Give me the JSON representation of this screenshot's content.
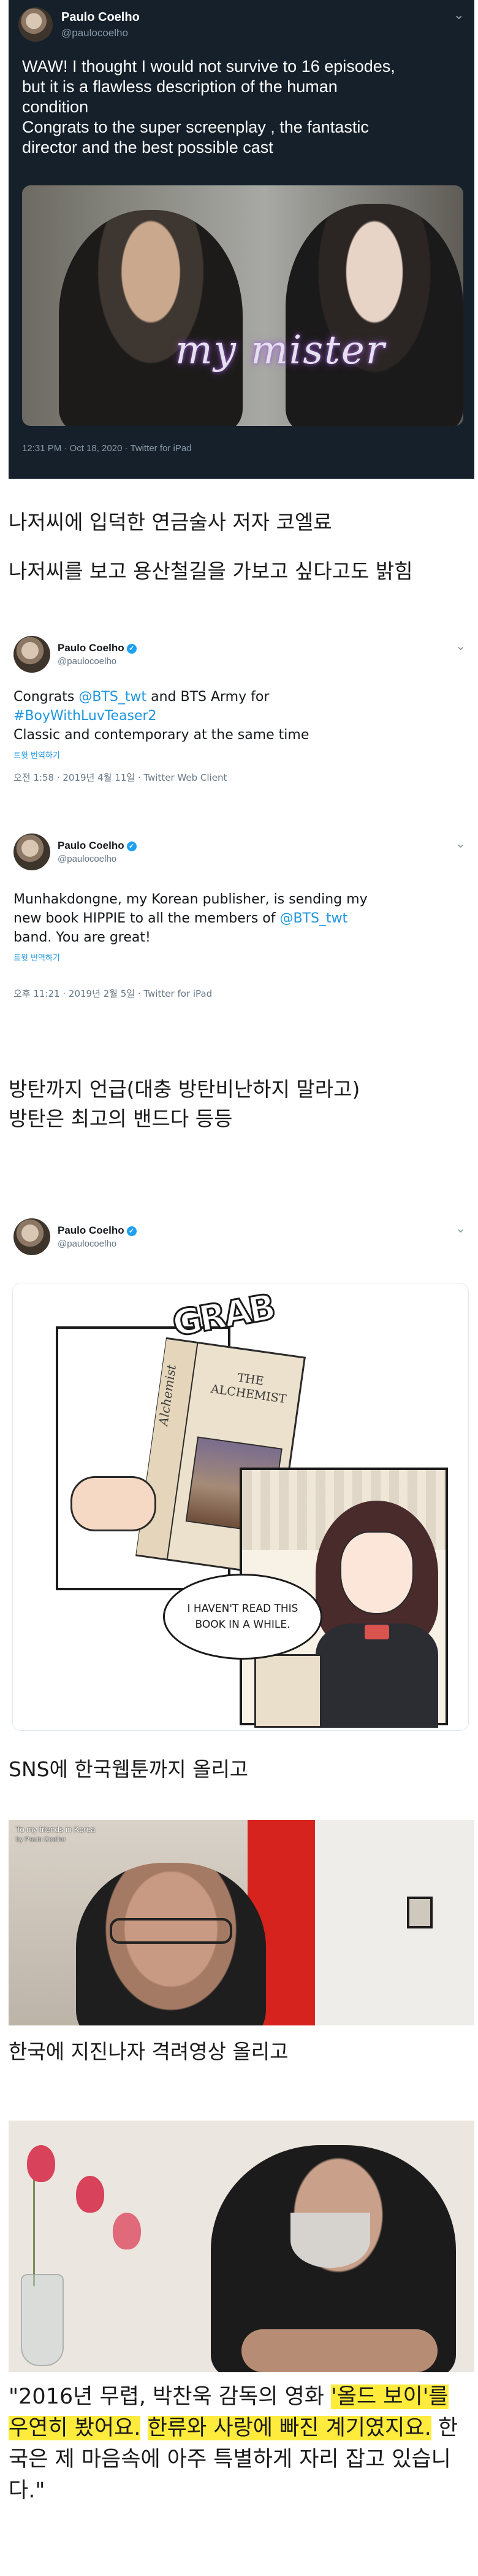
{
  "tweet1": {
    "name": "Paulo Coelho",
    "handle": "@paulocoelho",
    "text_lines": [
      "WAW! I thought I would not survive to 16 episodes,",
      "but it is a flawless description of the human",
      "condition",
      "Congrats to the super screenplay , the fantastic",
      "director and the best possible cast"
    ],
    "image_title": "my mister",
    "meta": "12:31 PM · Oct 18, 2020 · Twitter for iPad"
  },
  "caption1": "나저씨에 입덕한 연금술사 저자 코엘료",
  "caption2": "나저씨를 보고 용산철길을 가보고 싶다고도 밝힘",
  "tweet2": {
    "name": "Paulo Coelho",
    "handle": "@paulocoelho",
    "line1_pre": "Congrats ",
    "line1_mention": "@BTS_twt",
    "line1_post": " and BTS Army for",
    "line2_hashtag": "#BoyWithLuvTeaser2",
    "line3": "Classic and contemporary at the same time",
    "translate": "트윗 번역하기",
    "meta": "오전 1:58 · 2019년 4월 11일 · Twitter Web Client"
  },
  "tweet3": {
    "name": "Paulo Coelho",
    "handle": "@paulocoelho",
    "line1": "Munhakdongne, my Korean publisher, is sending my",
    "line2_pre": "new book HIPPIE to all the members of ",
    "line2_mention": "@BTS_twt",
    "line3": "band. You are great!",
    "translate": "트윗 번역하기",
    "meta": "오후 11:21 · 2019년 2월 5일 · Twitter for iPad"
  },
  "caption3": "방탄까지 언급(대충 방탄비난하지 말라고)",
  "caption4": "방탄은 최고의 밴드다 등등",
  "tweet4": {
    "name": "Paulo Coelho",
    "handle": "@paulocoelho",
    "comic": {
      "sfx": "GRAB",
      "book_title": "THE ALCHEMIST",
      "book_spine": "Alchemist",
      "bubble": "I HAVEN'T READ THIS BOOK IN A WHILE."
    }
  },
  "caption5": "SNS에 한국웹툰까지 올리고",
  "video": {
    "title": "To my friends in Korea",
    "subtitle": "by Paulo Coelho"
  },
  "caption6": "한국에 지진나자 격려영상 올리고",
  "quote": {
    "p1": "\"2016년 무렵, 박찬욱 감독의 영화 ",
    "h1": "'올드 보이'를 우연히 봤어요.",
    "p2": " ",
    "h2": "한류와 사랑에 빠진 계기였지요.",
    "p3": " 한국은 제 마음속에 아주 특별하게 자리 잡고 있습니다.\""
  },
  "colors": {
    "dark_bg": "#15202b",
    "link_blue": "#1b95e0",
    "highlight": "#ffeb3b",
    "verified": "#1da1f2"
  },
  "icons": [
    "chevron-down-icon",
    "verified-badge-icon"
  ]
}
